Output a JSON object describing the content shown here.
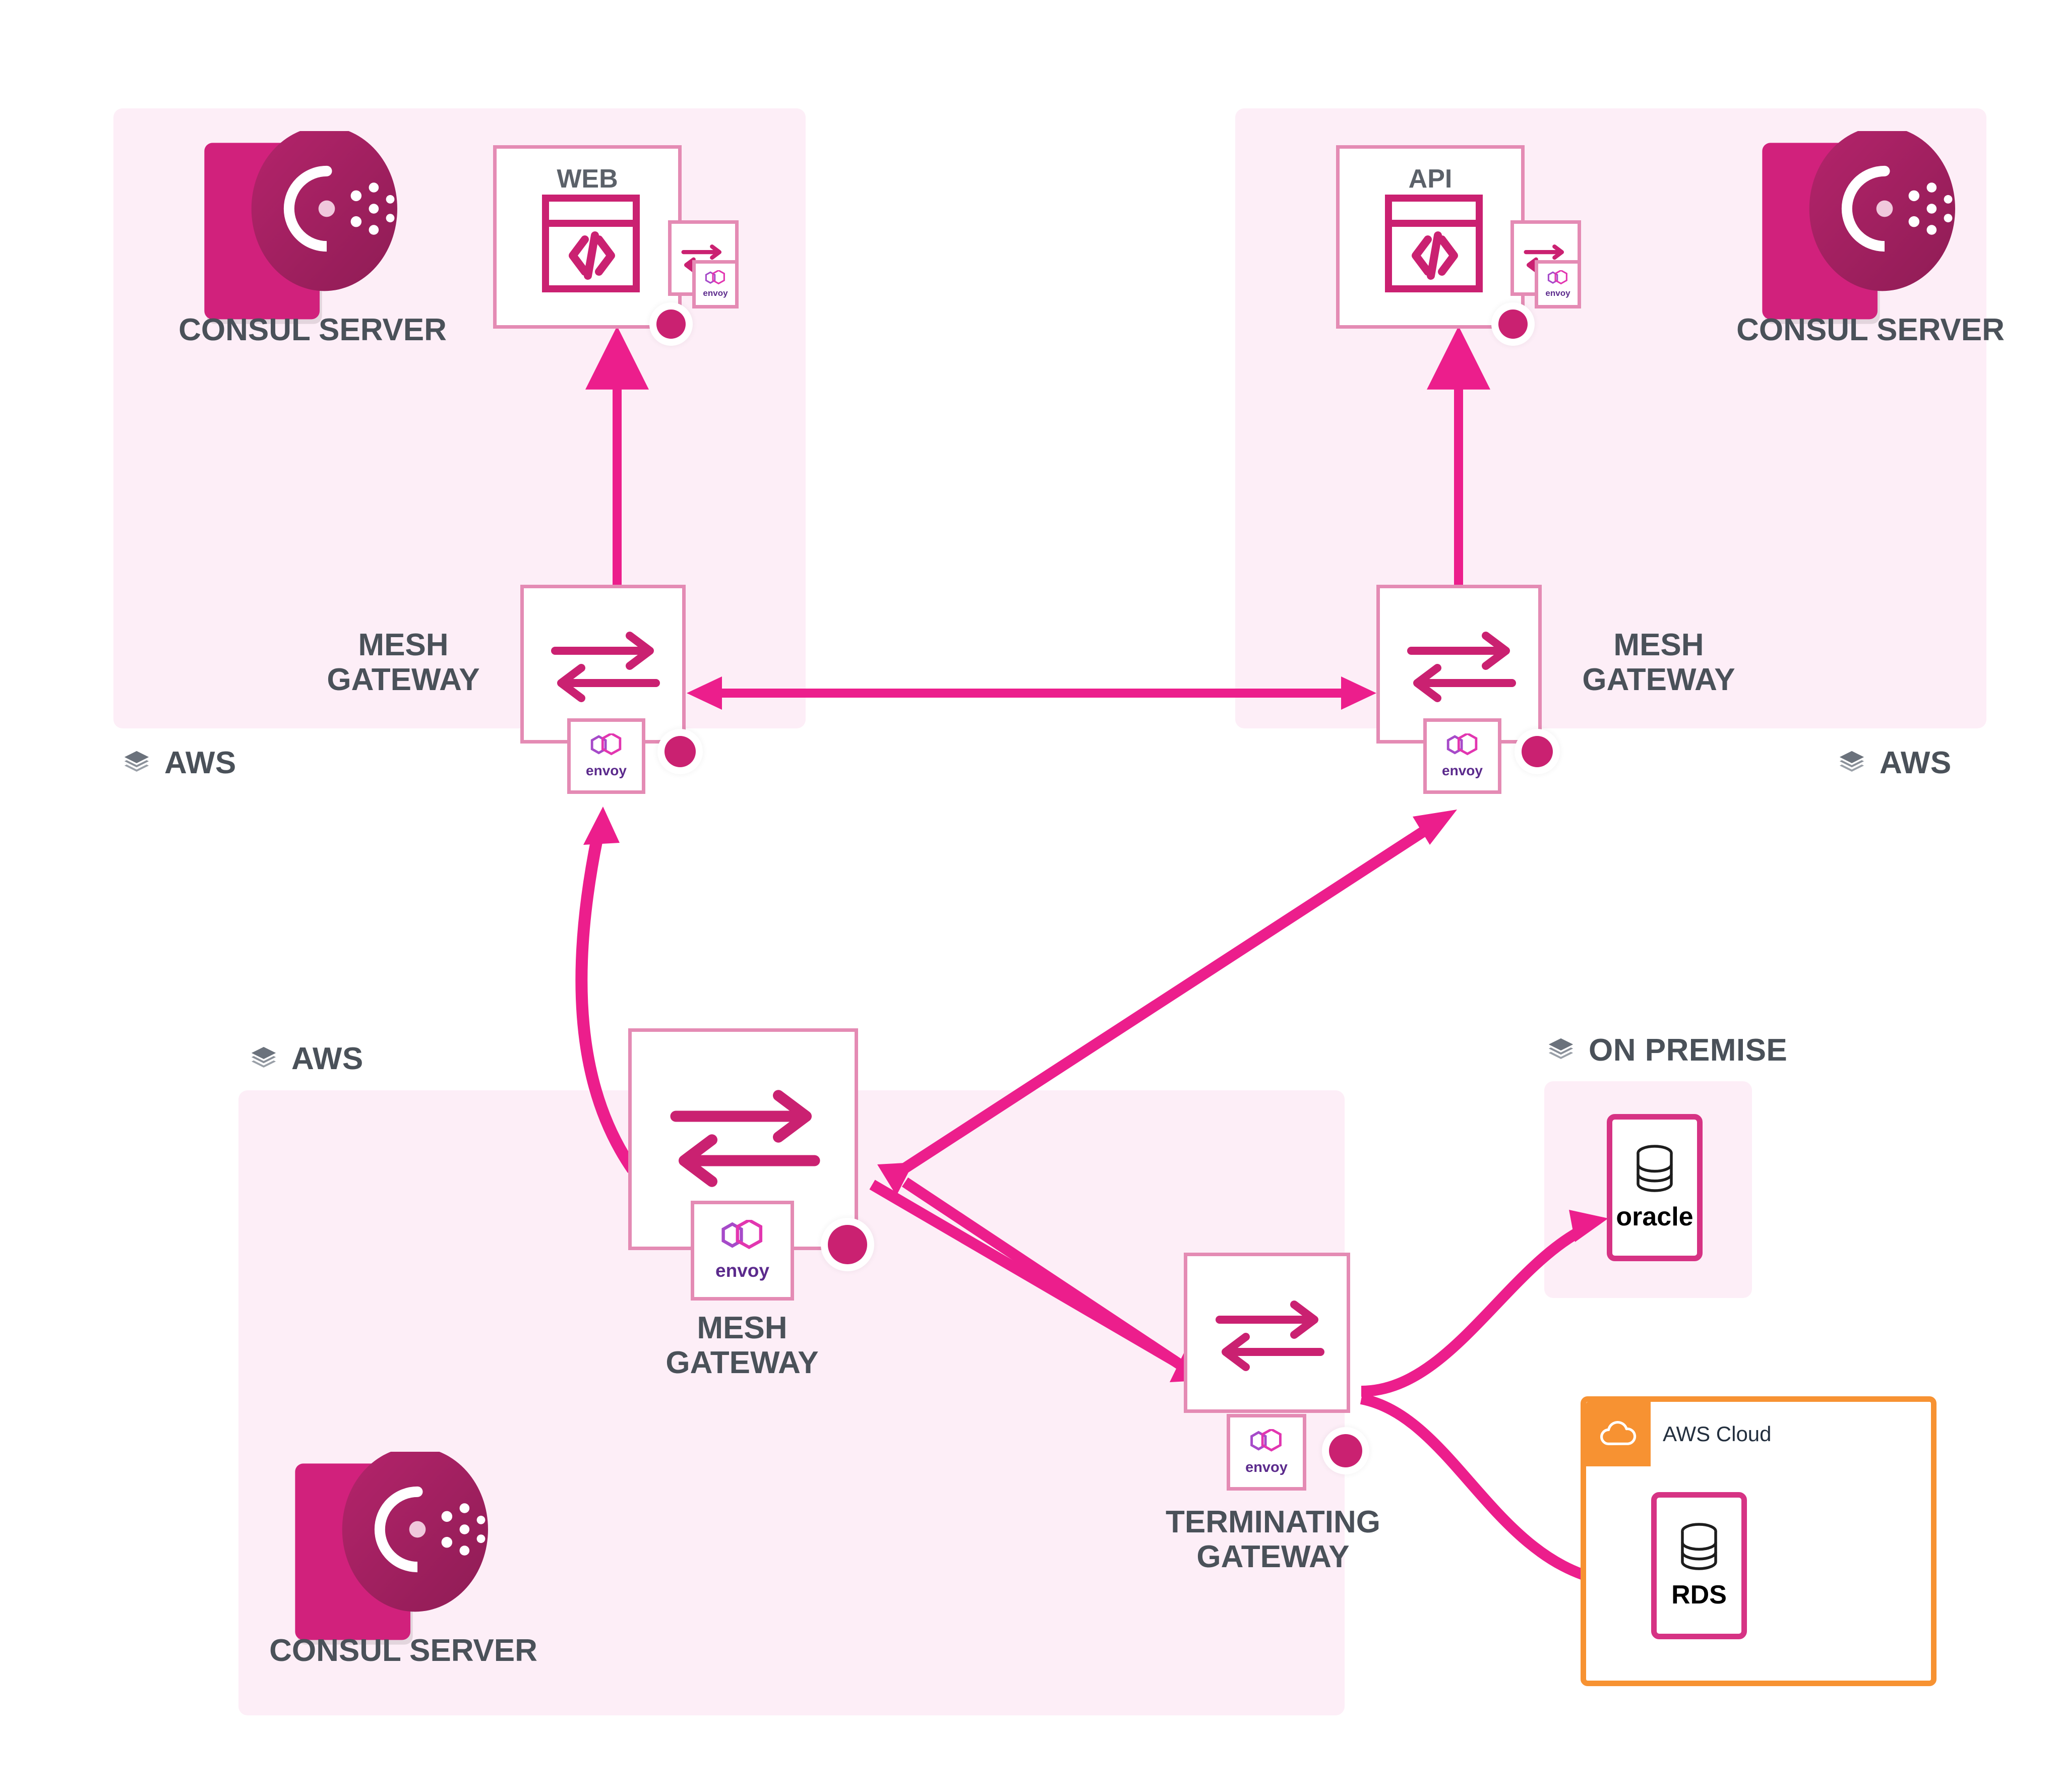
{
  "diagram": {
    "title": "Consul service mesh multi-datacenter architecture",
    "accent_pink": "#ec1e8c",
    "accent_magenta": "#ca2171",
    "region_fill": "#fdeef7",
    "label_gray": "#4a5159",
    "aws_orange": "#f79232"
  },
  "zones": [
    {
      "id": "aws-left",
      "label": "AWS",
      "icon": "layers-icon"
    },
    {
      "id": "aws-right",
      "label": "AWS",
      "icon": "layers-icon"
    },
    {
      "id": "aws-bottom",
      "label": "AWS",
      "icon": "layers-icon"
    },
    {
      "id": "on-premise",
      "label": "ON PREMISE",
      "icon": "layers-icon"
    }
  ],
  "consul_servers": [
    {
      "id": "consul-left",
      "label": "CONSUL SERVER"
    },
    {
      "id": "consul-right",
      "label": "CONSUL SERVER"
    },
    {
      "id": "consul-bottom",
      "label": "CONSUL SERVER"
    }
  ],
  "services": [
    {
      "id": "web",
      "title": "WEB",
      "icon": "code-window-icon",
      "sidecar": "envoy",
      "sidecar_label": "envoy"
    },
    {
      "id": "api",
      "title": "API",
      "icon": "code-window-icon",
      "sidecar": "envoy",
      "sidecar_label": "envoy"
    }
  ],
  "gateways": [
    {
      "id": "mesh-gateway-left",
      "label": "MESH\nGATEWAY",
      "icon": "exchange-arrows-icon",
      "sidecar_label": "envoy"
    },
    {
      "id": "mesh-gateway-right",
      "label": "MESH\nGATEWAY",
      "icon": "exchange-arrows-icon",
      "sidecar_label": "envoy"
    },
    {
      "id": "mesh-gateway-bottom",
      "label": "MESH\nGATEWAY",
      "icon": "exchange-arrows-icon",
      "sidecar_label": "envoy"
    },
    {
      "id": "terminating-gateway",
      "label": "TERMINATING\nGATEWAY",
      "icon": "exchange-arrows-icon",
      "sidecar_label": "envoy"
    }
  ],
  "databases": [
    {
      "id": "oracle",
      "label": "oracle",
      "icon": "database-cylinder-icon",
      "zone": "on-premise"
    },
    {
      "id": "rds",
      "label": "RDS",
      "icon": "database-cylinder-icon",
      "zone": "aws-cloud"
    }
  ],
  "aws_cloud_box": {
    "label": "AWS Cloud",
    "icon": "cloud-icon"
  },
  "connections": [
    {
      "from": "mesh-gateway-left",
      "to": "web",
      "style": "straight",
      "direction": "up"
    },
    {
      "from": "mesh-gateway-right",
      "to": "api",
      "style": "straight",
      "direction": "up"
    },
    {
      "from": "mesh-gateway-left",
      "to": "mesh-gateway-right",
      "style": "straight",
      "direction": "both"
    },
    {
      "from": "mesh-gateway-bottom",
      "to": "mesh-gateway-left",
      "style": "curved",
      "direction": "up"
    },
    {
      "from": "mesh-gateway-bottom",
      "to": "mesh-gateway-right",
      "style": "straight",
      "direction": "up"
    },
    {
      "from": "terminating-gateway",
      "to": "mesh-gateway-bottom",
      "style": "straight",
      "direction": "up"
    },
    {
      "from": "mesh-gateway-bottom",
      "to": "terminating-gateway",
      "style": "straight",
      "direction": "down"
    },
    {
      "from": "terminating-gateway",
      "to": "oracle",
      "style": "curved",
      "direction": "right"
    },
    {
      "from": "terminating-gateway",
      "to": "rds",
      "style": "curved",
      "direction": "right"
    }
  ]
}
